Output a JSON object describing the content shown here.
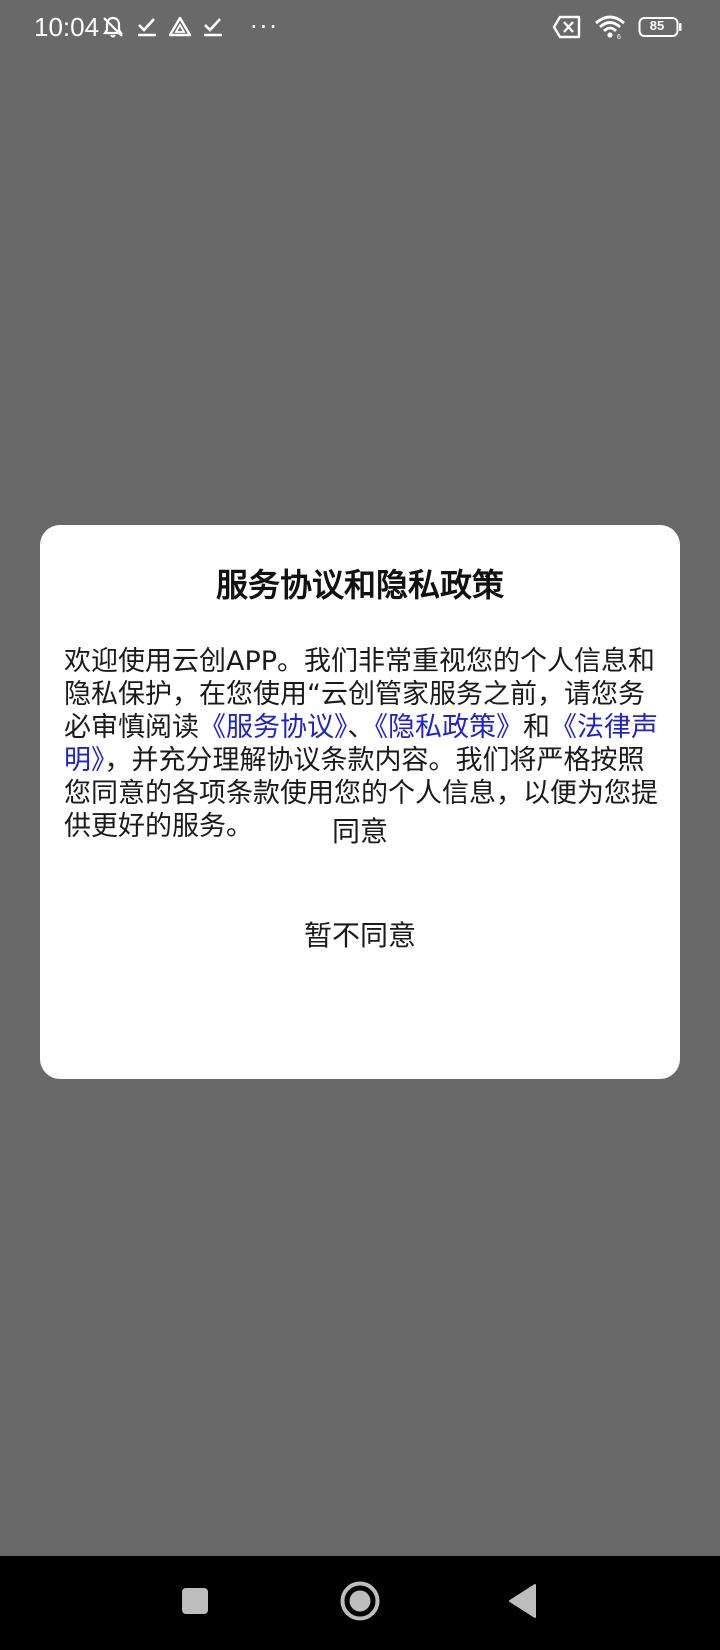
{
  "status_bar": {
    "time": "10:04",
    "more_indicator": "···",
    "battery_level": "85",
    "left_icons": [
      "mute-icon",
      "check-icon",
      "drive-icon",
      "check-icon"
    ],
    "right_icons": [
      "no-sim-icon",
      "wifi-icon",
      "battery-icon"
    ]
  },
  "dialog": {
    "title": "服务协议和隐私政策",
    "message": {
      "part1": "欢迎使用云创APP。我们非常重视您的个人信息和隐私保护，在您使用“云创管家服务之前，请您务必审慎阅读",
      "link_service": "《服务协议》",
      "sep1": "、",
      "link_privacy": "《隐私政策》",
      "sep2": "和",
      "link_legal": "《法律声明》",
      "part2": "，并充分理解协议条款内容。我们将严格按照您同意的各项条款使用您的个人信息，以便为您提供更好的服务。"
    },
    "agree_label": "同意",
    "disagree_label": "暂不同意"
  },
  "nav_bar": {
    "buttons": [
      "recents-icon",
      "home-icon",
      "back-icon"
    ]
  },
  "colors": {
    "scrim": "#696969",
    "dialog_bg": "#ffffff",
    "link": "#2222cc",
    "nav_bg": "#000000"
  }
}
